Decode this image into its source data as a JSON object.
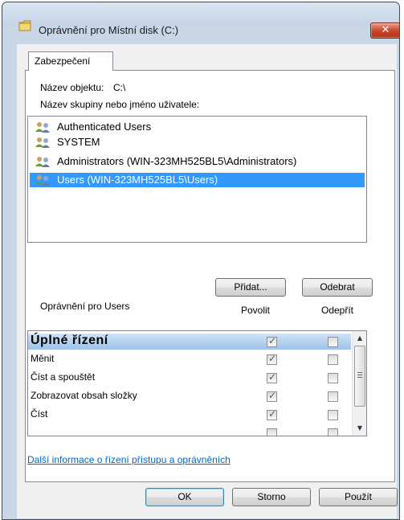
{
  "window": {
    "title": "Oprávnění pro Místní disk (C:)",
    "close_glyph": "✕"
  },
  "tabs": [
    {
      "label": "Zabezpečení",
      "active": true
    }
  ],
  "object_name": {
    "label": "Název objektu:",
    "value": "C:\\"
  },
  "groups": {
    "label": "Název skupiny nebo jméno uživatele:",
    "items": [
      {
        "label": "Authenticated Users",
        "selected": false
      },
      {
        "label": "SYSTEM",
        "selected": false
      },
      {
        "label": "Administrators (WIN-323MH525BL5\\Administrators)",
        "selected": false
      },
      {
        "label": "Users (WIN-323MH525BL5\\Users)",
        "selected": true
      }
    ],
    "add_label": "Přidat...",
    "remove_label": "Odebrat"
  },
  "permissions": {
    "label": "Oprávnění pro Users",
    "allow_header": "Povolit",
    "deny_header": "Odepřít",
    "rows": [
      {
        "name": "Úplné řízení",
        "allow": true,
        "deny": false
      },
      {
        "name": "Měnit",
        "allow": true,
        "deny": false
      },
      {
        "name": "Číst a spouštět",
        "allow": true,
        "deny": false
      },
      {
        "name": "Zobrazovat obsah složky",
        "allow": true,
        "deny": false
      },
      {
        "name": "Číst",
        "allow": true,
        "deny": false
      }
    ]
  },
  "help_link": "Další informace o řízení přístupu a oprávněních",
  "buttons": {
    "ok": "OK",
    "cancel": "Storno",
    "apply": "Použít"
  },
  "colors": {
    "selection": "#3399ff",
    "link": "#0066cc",
    "close": "#c9482c"
  }
}
